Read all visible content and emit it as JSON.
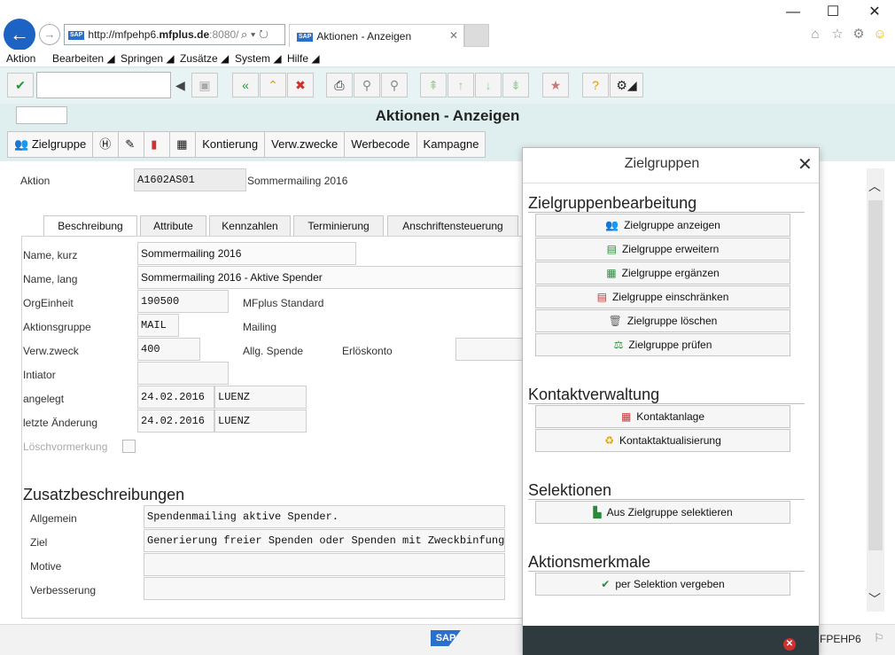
{
  "browser": {
    "url_prefix": "http://mfpehp6.",
    "url_host": "mfplus.de",
    "url_suffix": ":8080/",
    "tab_title": "Aktionen - Anzeigen"
  },
  "menu": [
    "Aktion",
    "Bearbeiten",
    "Springen",
    "Zusätze",
    "System",
    "Hilfe"
  ],
  "page": {
    "title": "Aktionen - Anzeigen"
  },
  "app_toolbar": [
    "Zielgruppe",
    "Kontierung",
    "Verw.zwecke",
    "Werbecode",
    "Kampagne"
  ],
  "header": {
    "aktion_label": "Aktion",
    "aktion_value": "A1602AS01",
    "aktion_desc": "Sommermailing 2016"
  },
  "tabs": [
    "Beschreibung",
    "Attribute",
    "Kennzahlen",
    "Terminierung",
    "Anschriftensteuerung"
  ],
  "form": {
    "name_kurz_label": "Name, kurz",
    "name_kurz_value": "Sommermailing 2016",
    "name_lang_label": "Name, lang",
    "name_lang_value": "Sommermailing 2016 - Aktive Spender",
    "orgeinheit_label": "OrgEinheit",
    "orgeinheit_value": "190500",
    "orgeinheit_desc": "MFplus Standard",
    "aktionsgruppe_label": "Aktionsgruppe",
    "aktionsgruppe_value": "MAIL",
    "aktionsgruppe_desc": "Mailing",
    "verwzweck_label": "Verw.zweck",
    "verwzweck_value": "400",
    "verwzweck_desc": "Allg. Spende",
    "erloeskonto_label": "Erlöskonto",
    "intiator_label": "Intiator",
    "angelegt_label": "angelegt",
    "angelegt_date": "24.02.2016",
    "angelegt_user": "LUENZ",
    "aenderung_label": "letzte Änderung",
    "aenderung_date": "24.02.2016",
    "aenderung_user": "LUENZ",
    "loesch_label": "Löschvormerkung"
  },
  "zusatz": {
    "heading": "Zusatzbeschreibungen",
    "allgemein_label": "Allgemein",
    "allgemein_value": "Spendenmailing aktive Spender.",
    "ziel_label": "Ziel",
    "ziel_value": "Generierung freier Spenden oder Spenden mit Zweckbinfung",
    "motive_label": "Motive",
    "verbesserung_label": "Verbesserung"
  },
  "status": {
    "system": "FPEHP6"
  },
  "dialog": {
    "title": "Zielgruppen",
    "groups": {
      "bearbeitung": "Zielgruppenbearbeitung",
      "kontakt": "Kontaktverwaltung",
      "selektionen": "Selektionen",
      "merkmale": "Aktionsmerkmale"
    },
    "buttons": {
      "anzeigen": "Zielgruppe anzeigen",
      "erweitern": "Zielgruppe erweitern",
      "ergaenzen": "Zielgruppe ergänzen",
      "einschraenken": "Zielgruppe einschränken",
      "loeschen": "Zielgruppe löschen",
      "pruefen": "Zielgruppe prüfen",
      "kontaktanlage": "Kontaktanlage",
      "kontaktaktualisierung": "Kontaktaktualisierung",
      "selektieren": "Aus Zielgruppe selektieren",
      "vergeben": "per Selektion vergeben"
    }
  },
  "colors": {
    "accent_blue": "#1c63c4",
    "sap_bg": "#dfeff0",
    "dialog_footer": "#2f3a3e"
  }
}
